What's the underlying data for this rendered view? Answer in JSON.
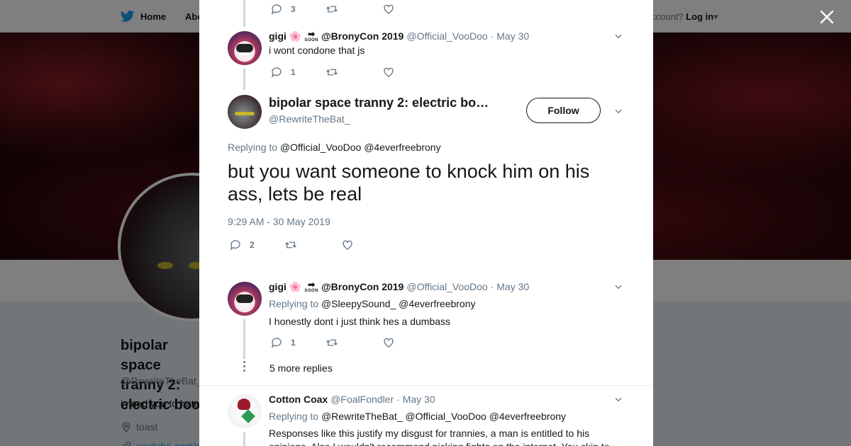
{
  "topbar": {
    "home_label": "Home",
    "about_label": "Abo",
    "account_prompt": "ccount?",
    "login_label": "Log in"
  },
  "profile": {
    "name": "bipolar space tranny 2: electric boo",
    "handle": "@RewriteTheBat_",
    "bio": "i need you to hate",
    "location": "toast",
    "link": "youtube.com/c"
  },
  "thread": {
    "top_actions": {
      "replies": "3"
    },
    "reply1": {
      "name": "gigi",
      "emoji": "🌸",
      "soon_text": "SOON",
      "name_suffix": "@BronyCon 2019",
      "handle": "@Official_VooDoo",
      "date": "· May 30",
      "text": "i wont condone that js",
      "replies": "1"
    },
    "main": {
      "name": "bipolar space tranny 2: electric bo…",
      "handle": "@RewriteTheBat_",
      "follow_label": "Follow",
      "replying_label": "Replying to",
      "replying_to_1": "@Official_VooDoo",
      "replying_to_2": "@4everfreebrony",
      "text": "but you want someone to knock him on his ass, lets be real",
      "timestamp": "9:29 AM - 30 May 2019",
      "replies": "2"
    },
    "reply2": {
      "name": "gigi",
      "emoji": "🌸",
      "soon_text": "SOON",
      "name_suffix": "@BronyCon 2019",
      "handle": "@Official_VooDoo",
      "date": "· May 30",
      "replying_label": "Replying to",
      "replying_to_1": "@SleepySound_",
      "replying_to_2": "@4everfreebrony",
      "text": "I honestly dont i just think hes a dumbass",
      "replies": "1",
      "more_replies": "5 more replies"
    },
    "reply3": {
      "name": "Cotton Coax",
      "handle": "@FoalFondler",
      "date": "· May 30",
      "replying_label": "Replying to",
      "replying_to_1": "@RewriteTheBat_",
      "replying_to_2": "@Official_VooDoo",
      "replying_to_3": "@4everfreebrony",
      "text": "Responses like this justify my disgust for trannies, a man is entitled to his opinions. Also I wouldn't recommend picking fights on the internet. You skip to"
    }
  }
}
